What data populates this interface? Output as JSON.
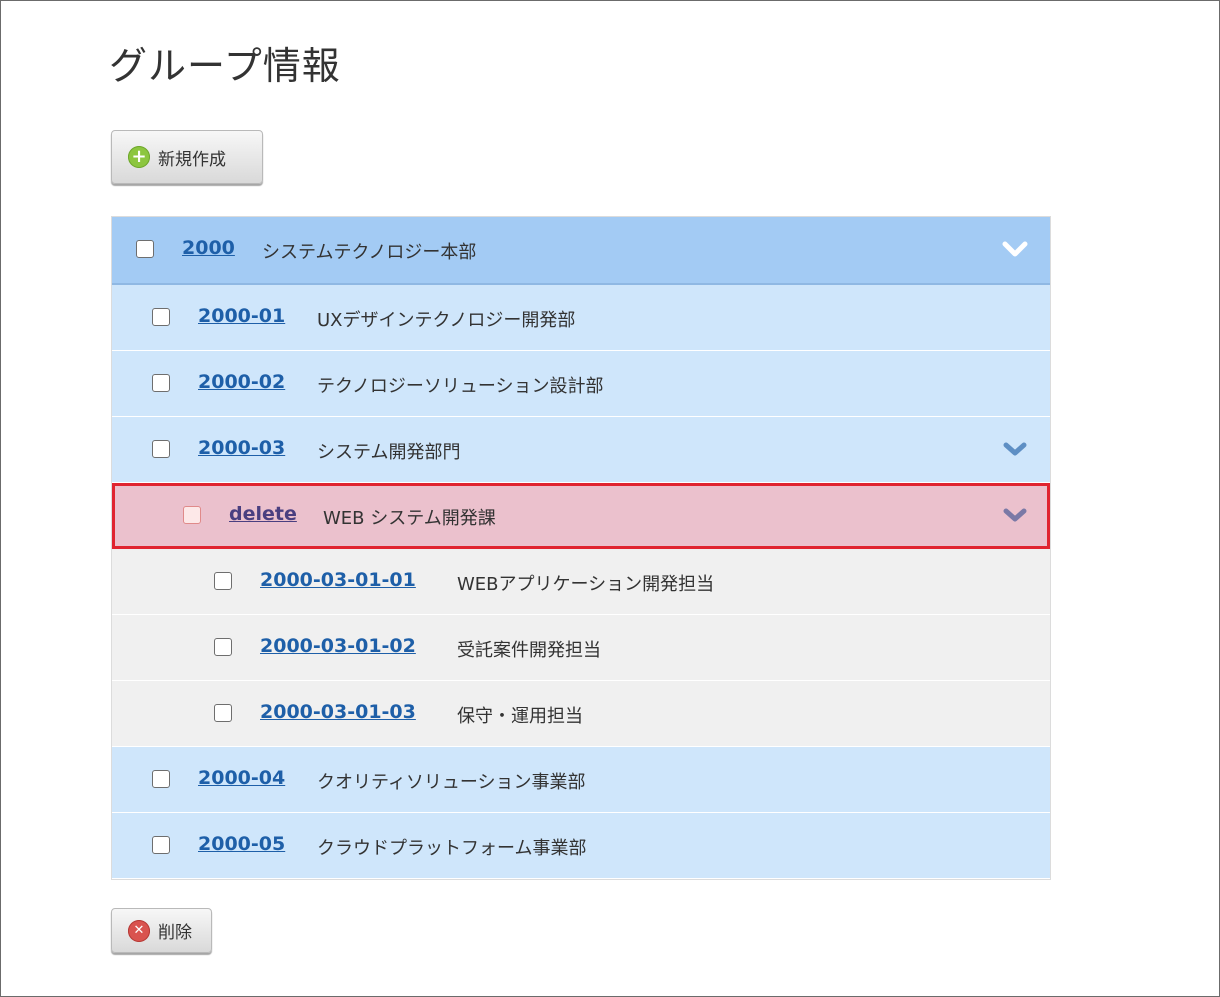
{
  "page": {
    "title": "グループ情報"
  },
  "toolbar": {
    "new_label": "新規作成",
    "delete_label": "削除"
  },
  "groups": [
    {
      "code": "2000",
      "name": "システムテクノロジー本部"
    },
    {
      "code": "2000-01",
      "name": "UXデザインテクノロジー開発部"
    },
    {
      "code": "2000-02",
      "name": "テクノロジーソリューション設計部"
    },
    {
      "code": "2000-03",
      "name": "システム開発部門"
    },
    {
      "code": "delete",
      "name": "WEB システム開発課"
    },
    {
      "code": "2000-03-01-01",
      "name": "WEBアプリケーション開発担当"
    },
    {
      "code": "2000-03-01-02",
      "name": "受託案件開発担当"
    },
    {
      "code": "2000-03-01-03",
      "name": "保守・運用担当"
    },
    {
      "code": "2000-04",
      "name": "クオリティソリューション事業部"
    },
    {
      "code": "2000-05",
      "name": "クラウドプラットフォーム事業部"
    }
  ],
  "colors": {
    "accent_link": "#1e5fa8",
    "row_top": "#a3cbf4",
    "row_level1": "#cfe6fb",
    "row_leaf": "#f0f0f0",
    "row_selected": "#ebc1cd",
    "selected_outline": "#e02430"
  }
}
